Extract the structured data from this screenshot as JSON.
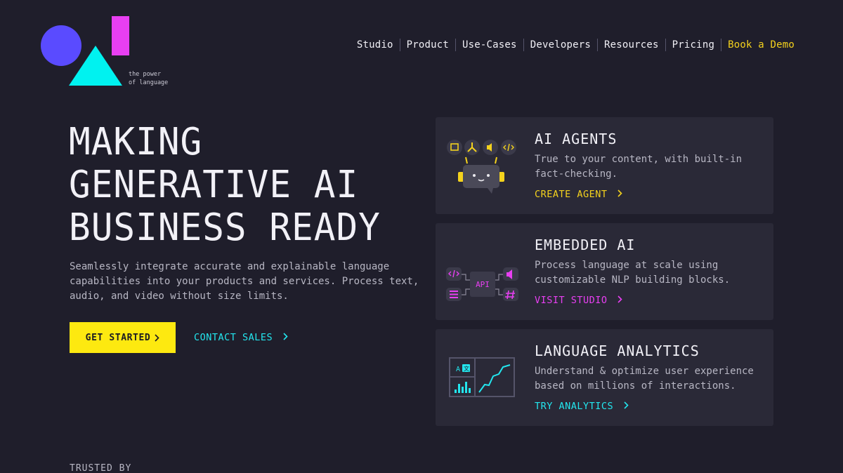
{
  "logo": {
    "tagline_line1": "the power",
    "tagline_line2": "of language"
  },
  "nav": {
    "items": [
      "Studio",
      "Product",
      "Use-Cases",
      "Developers",
      "Resources",
      "Pricing"
    ],
    "demo": "Book a Demo"
  },
  "hero": {
    "title_line1": "MAKING",
    "title_line2": "GENERATIVE AI",
    "title_line3": "BUSINESS READY",
    "subtitle": "Seamlessly integrate accurate and explainable language capabilities into your products and services. Process text, audio, and video without size limits.",
    "cta_primary": "GET STARTED",
    "cta_secondary": "CONTACT SALES"
  },
  "cards": [
    {
      "title": "AI AGENTS",
      "description": "True to your content, with built-in fact-checking.",
      "link": "CREATE AGENT",
      "icon": "robot-agent-icon"
    },
    {
      "title": "EMBEDDED AI",
      "description": "Process language at scale using customizable NLP building blocks.",
      "link": "VISIT STUDIO",
      "icon": "api-network-icon",
      "icon_label": "API"
    },
    {
      "title": "LANGUAGE ANALYTICS",
      "description": "Understand & optimize user experience based on millions of interactions.",
      "link": "TRY ANALYTICS",
      "icon": "analytics-dashboard-icon"
    }
  ],
  "trusted": "TRUSTED BY",
  "colors": {
    "background": "#1f1e2b",
    "card": "#2a2937",
    "yellow": "#fde910",
    "magenta": "#e83ff2",
    "cyan": "#23e6ee",
    "purple": "#5a4bff"
  }
}
